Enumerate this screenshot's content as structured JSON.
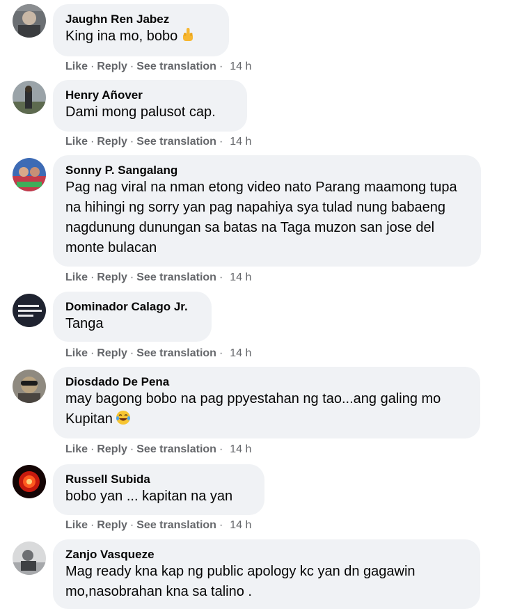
{
  "action_labels": {
    "like": "Like",
    "reply": "Reply",
    "see_translation": "See translation",
    "dot": "·"
  },
  "comments": [
    {
      "author": "Jaughn Ren Jabez",
      "text": "King ina mo, bobo",
      "emoji": "middle-finger-emoji",
      "time": "14 h"
    },
    {
      "author": "Henry Añover",
      "text": "Dami mong palusot cap.",
      "time": "14 h"
    },
    {
      "author": "Sonny P. Sangalang",
      "text": "Pag nag viral na nman etong video nato Parang maamong tupa na hihingi ng sorry yan pag napahiya sya tulad nung babaeng nagdunung dunungan sa batas na Taga muzon san jose del monte bulacan",
      "time": "14 h"
    },
    {
      "author": "Dominador Calago Jr.",
      "text": "Tanga",
      "time": "14 h"
    },
    {
      "author": "Diosdado De Pena",
      "text": "may bagong bobo na pag ppyestahan ng tao...ang galing mo Kupitan",
      "emoji": "laughing-tears-emoji",
      "time": "14 h"
    },
    {
      "author": "Russell Subida",
      "text": "bobo yan ... kapitan na yan",
      "time": "14 h"
    },
    {
      "author": "Zanjo Vasqueze",
      "text": "Mag ready kna kap ng public apology kc yan dn gagawin mo,nasobrahan kna sa talino ."
    }
  ],
  "colors": {
    "bubble": "#f0f2f5",
    "meta": "#65676b",
    "name": "#050505"
  }
}
